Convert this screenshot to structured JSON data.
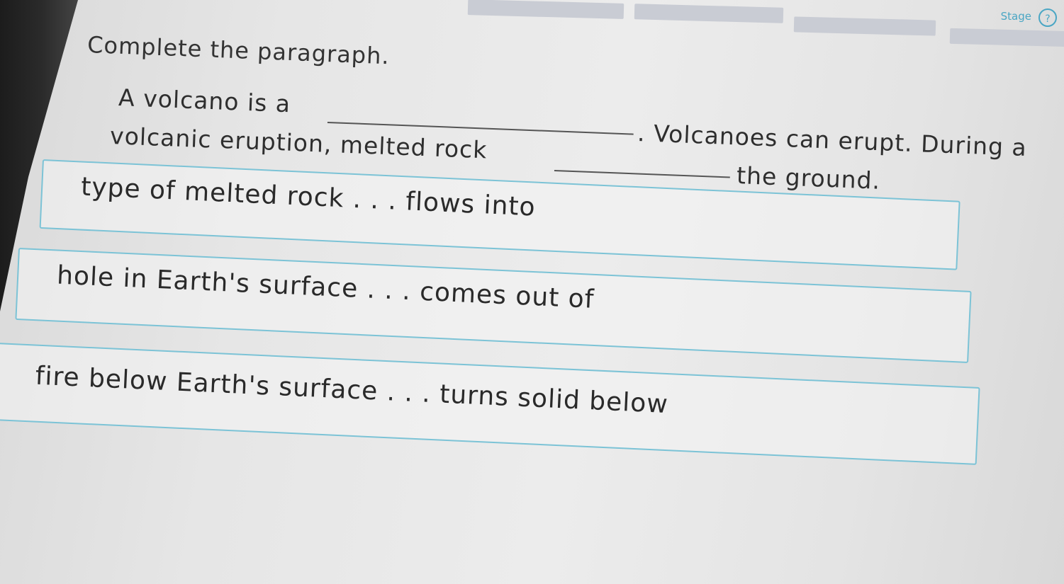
{
  "header": {
    "stage_label": "Stage",
    "stage_icon": "info-icon",
    "accent_color": "#4aa6c4"
  },
  "instructions": "Complete the paragraph.",
  "paragraph": {
    "line1_start": "A volcano is a",
    "line1_end": ". Volcanoes can erupt. During a",
    "line2_start": "volcanic eruption, melted rock",
    "line2_end": "the ground."
  },
  "options": [
    "type of melted rock . . . flows into",
    "hole in Earth's surface . . . comes out of",
    "fire below Earth's surface . . . turns solid below"
  ]
}
